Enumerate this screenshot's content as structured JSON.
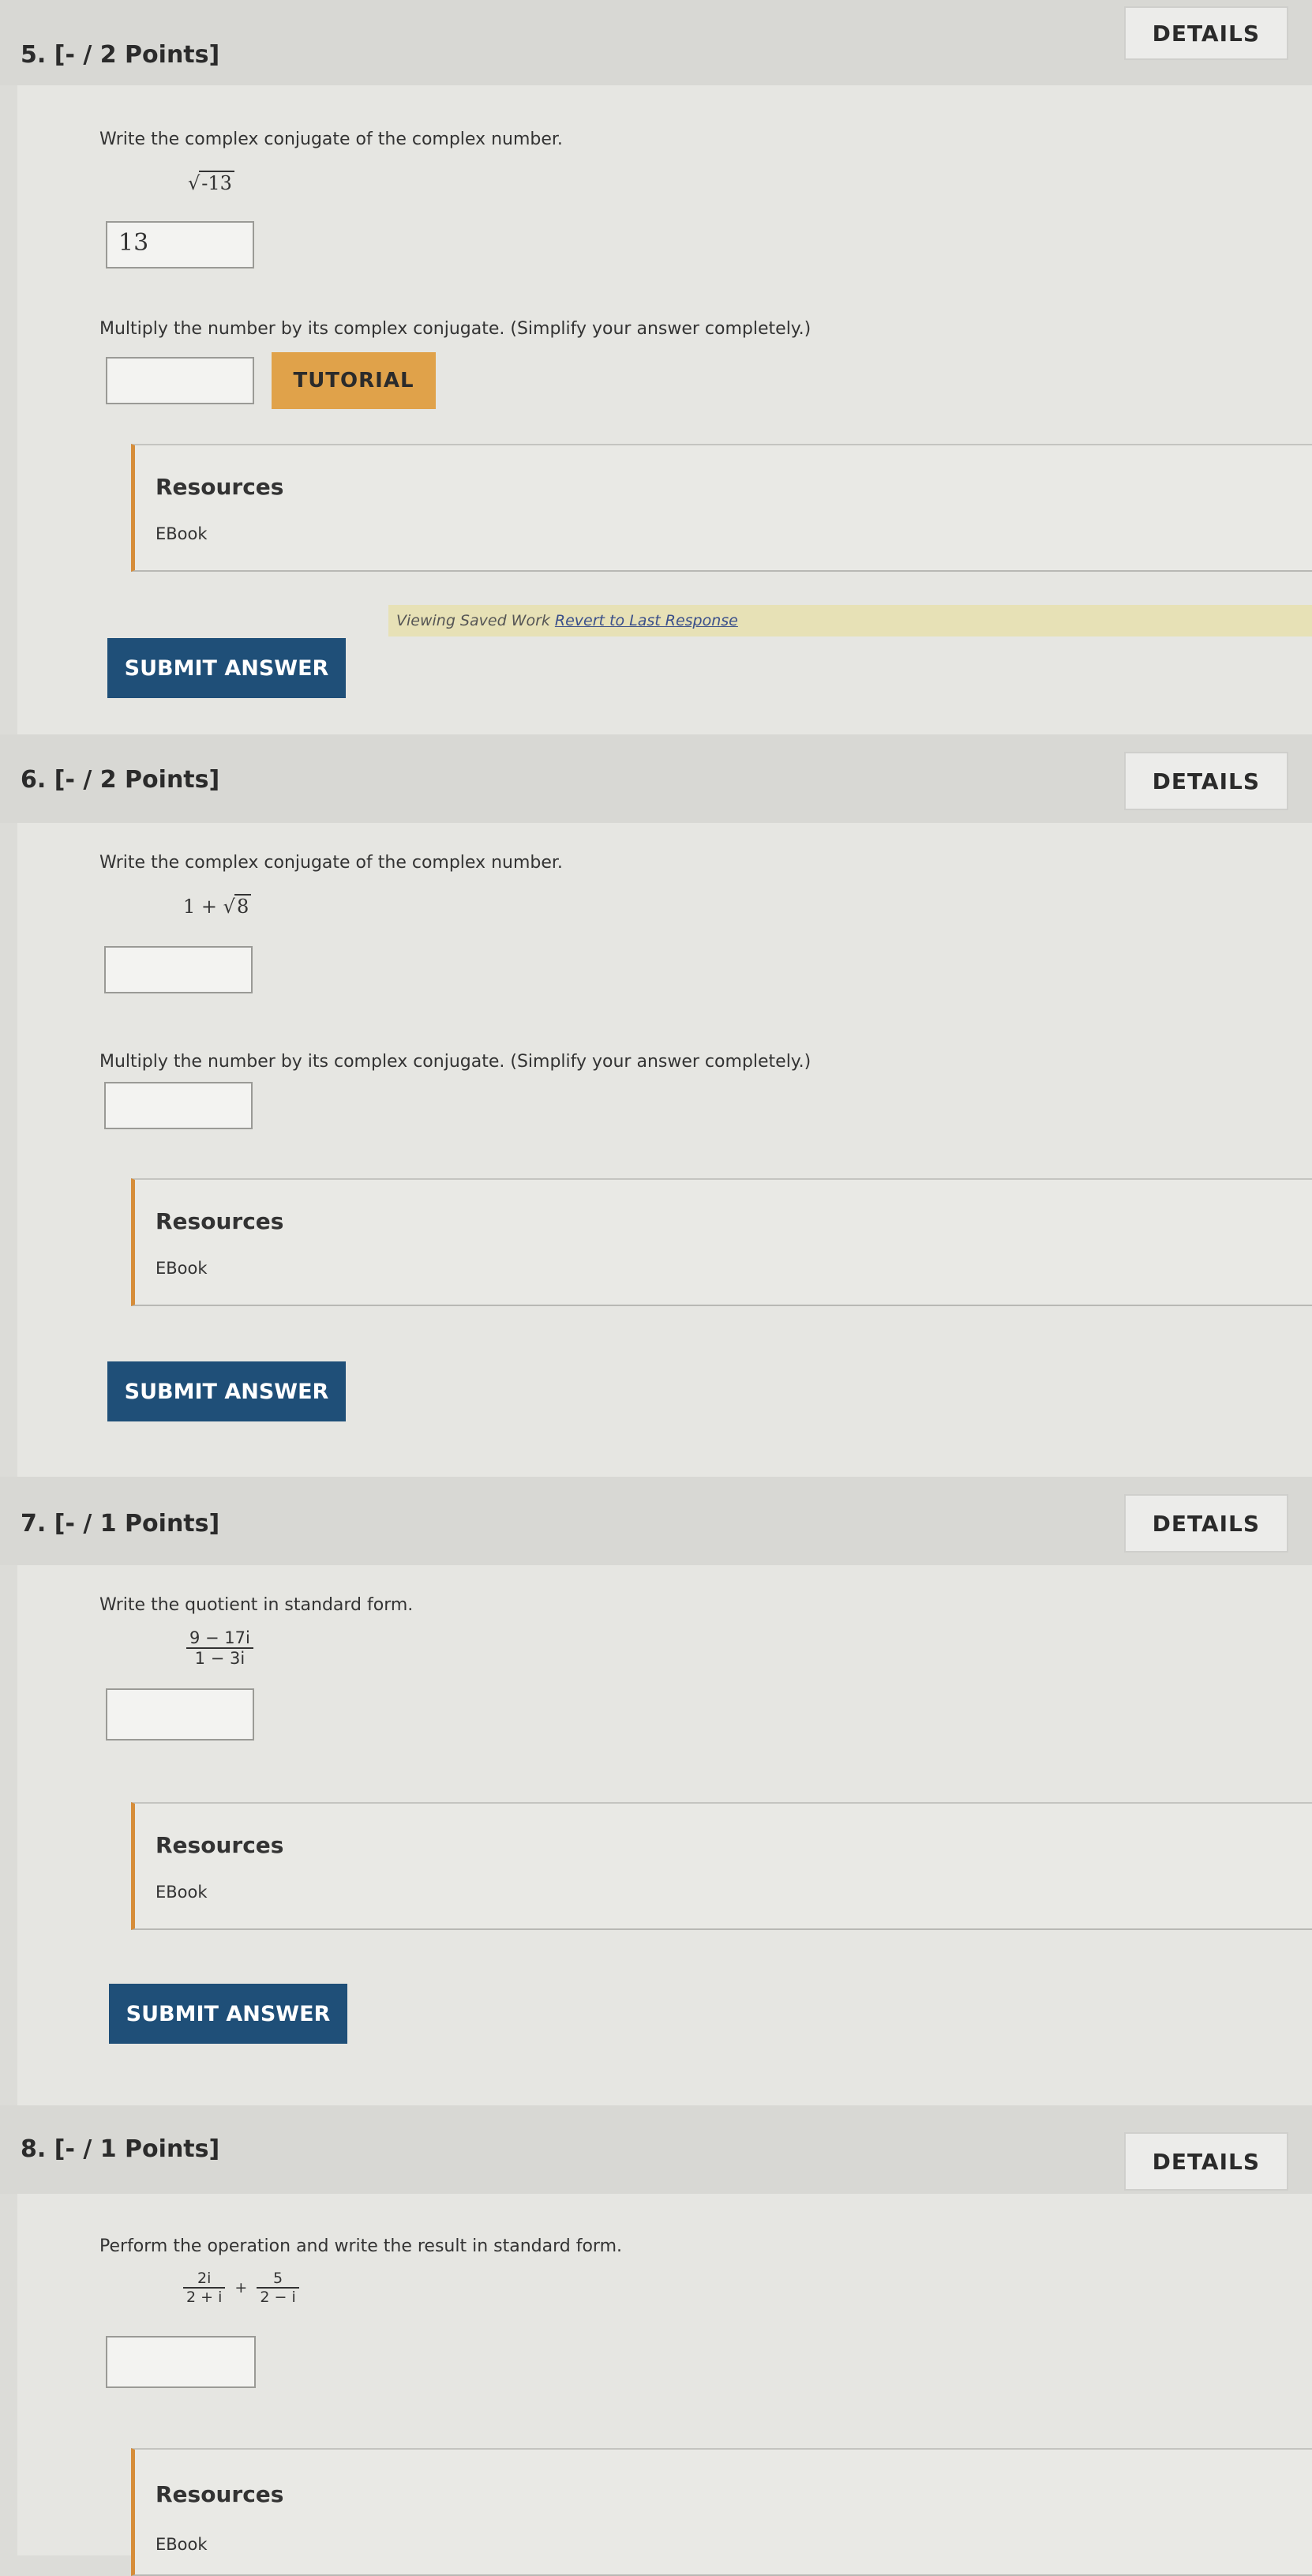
{
  "details_label": "DETAILS",
  "questions": [
    {
      "number": "5.",
      "points": "[- / 2 Points]",
      "prompt1": "Write the complex conjugate of the complex number.",
      "expression": "√-13",
      "expression_radicand": "-13",
      "answer1": "13",
      "prompt2": "Multiply the number by its complex conjugate. (Simplify your answer completely.)",
      "answer2": "",
      "tutorial": "TUTORIAL",
      "resources_title": "Resources",
      "resources_link": "EBook",
      "submit": "SUBMIT ANSWER",
      "banner_text": "Viewing Saved Work",
      "banner_link": "Revert to Last Response"
    },
    {
      "number": "6.",
      "points": "[- / 2 Points]",
      "prompt1": "Write the complex conjugate of the complex number.",
      "expression_lead": "1 + ",
      "expression_radicand": "8",
      "answer1": "",
      "prompt2": "Multiply the number by its complex conjugate. (Simplify your answer completely.)",
      "answer2": "",
      "resources_title": "Resources",
      "resources_link": "EBook",
      "submit": "SUBMIT ANSWER"
    },
    {
      "number": "7.",
      "points": "[- / 1 Points]",
      "prompt1": "Write the quotient in standard form.",
      "frac_num": "9 − 17i",
      "frac_den": "1 − 3i",
      "answer1": "",
      "resources_title": "Resources",
      "resources_link": "EBook",
      "submit": "SUBMIT ANSWER"
    },
    {
      "number": "8.",
      "points": "[- / 1 Points]",
      "prompt1": "Perform the operation and write the result in standard form.",
      "frac1_num": "2i",
      "frac1_den": "2 + i",
      "operator": "+",
      "frac2_num": "5",
      "frac2_den": "2 − i",
      "answer1": "",
      "resources_title": "Resources",
      "resources_link": "EBook"
    }
  ]
}
